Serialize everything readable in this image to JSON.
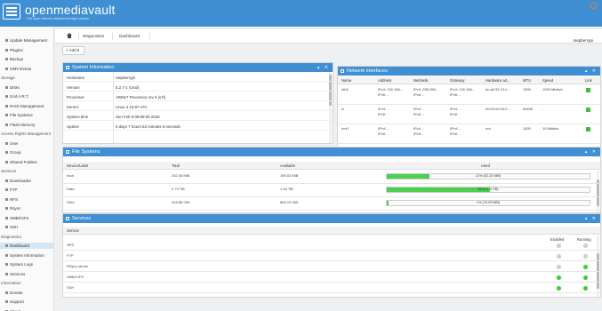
{
  "header": {
    "brand": "openmediavault",
    "tagline": "The open network attached storage solution"
  },
  "sidebar": {
    "items": [
      {
        "label": "Update Management",
        "type": "entry"
      },
      {
        "label": "Plugins",
        "type": "entry"
      },
      {
        "label": "Backup",
        "type": "entry"
      },
      {
        "label": "OMV-Extras",
        "type": "entry"
      },
      {
        "label": "Storage",
        "type": "cat"
      },
      {
        "label": "Disks",
        "type": "entry"
      },
      {
        "label": "S.M.A.R.T.",
        "type": "entry"
      },
      {
        "label": "RAID Management",
        "type": "entry"
      },
      {
        "label": "File Systems",
        "type": "entry"
      },
      {
        "label": "Flash Memory",
        "type": "entry"
      },
      {
        "label": "Access Rights Management",
        "type": "cat"
      },
      {
        "label": "User",
        "type": "entry"
      },
      {
        "label": "Group",
        "type": "entry"
      },
      {
        "label": "Shared Folders",
        "type": "entry"
      },
      {
        "label": "Services",
        "type": "cat"
      },
      {
        "label": "Downloader",
        "type": "entry"
      },
      {
        "label": "FTP",
        "type": "entry"
      },
      {
        "label": "NFS",
        "type": "entry"
      },
      {
        "label": "Rsync",
        "type": "entry"
      },
      {
        "label": "SMB/CIFS",
        "type": "entry"
      },
      {
        "label": "SSH",
        "type": "entry"
      },
      {
        "label": "Diagnostics",
        "type": "cat"
      },
      {
        "label": "Dashboard",
        "type": "entry",
        "active": true
      },
      {
        "label": "System Information",
        "type": "entry"
      },
      {
        "label": "System Logs",
        "type": "entry"
      },
      {
        "label": "Services",
        "type": "entry"
      },
      {
        "label": "Information",
        "type": "cat"
      },
      {
        "label": "Donate",
        "type": "entry"
      },
      {
        "label": "Support",
        "type": "entry"
      },
      {
        "label": "About",
        "type": "entry"
      }
    ]
  },
  "breadcrumb": {
    "items": [
      "Diagnostics",
      "Dashboard"
    ],
    "hostname": "raspberrypi"
  },
  "toolbar": {
    "add_label": "Add"
  },
  "system_info": {
    "title": "System Information",
    "rows": [
      {
        "key": "Hostname",
        "value": "raspberrypi"
      },
      {
        "key": "Version",
        "value": "5.2.7-1 (Usul)"
      },
      {
        "key": "Processor",
        "value": "ARMv7 Processor rev 3 (v7l)"
      },
      {
        "key": "Kernel",
        "value": "Linux 4.19.97-v7l+"
      },
      {
        "key": "System time",
        "value": "Sun Feb 9 09:59:06 2020"
      },
      {
        "key": "Uptime",
        "value": "0 days 7 hours 52 minutes 6 seconds"
      }
    ]
  },
  "network": {
    "title": "Network Interfaces",
    "columns": [
      "Name",
      "Address",
      "Netmask",
      "Gateway",
      "Hardware ad...",
      "MTU",
      "Speed",
      "Link"
    ],
    "rows": [
      {
        "name": "eth0",
        "address": [
          "IPv4: 192.168...",
          "IPv6: -"
        ],
        "netmask": [
          "IPv4: 255.255...",
          "IPv6: -"
        ],
        "gateway": [
          "IPv4: 192.168...",
          "IPv6: -"
        ],
        "hw": "dc:a6:32:13:1...",
        "mtu": "1500",
        "speed": "1000 Mbits/s",
        "link": true
      },
      {
        "name": "lo",
        "address": [
          "IPv4: -",
          "IPv6: -"
        ],
        "netmask": [
          "IPv4: -",
          "IPv6: -"
        ],
        "gateway": [
          "IPv4: -",
          "IPv6: -"
        ],
        "hw": "00:00:00:00:0...",
        "mtu": "65536",
        "speed": "-",
        "link": true
      },
      {
        "name": "tun0",
        "address": [
          "IPv4: -",
          "IPv6: -"
        ],
        "netmask": [
          "IPv4: -",
          "IPv6: -"
        ],
        "gateway": [
          "IPv4: -",
          "IPv6: -"
        ],
        "hw": "n/a",
        "mtu": "1500",
        "speed": "10 Mbits/s",
        "link": true
      }
    ]
  },
  "filesystems": {
    "title": "File Systems",
    "columns": [
      "Device/Label",
      "Total",
      "Available",
      "Used"
    ],
    "rows": [
      {
        "label": "boot",
        "total": "252.06 MiB",
        "available": "199.83 MiB",
        "used_pct": 21,
        "used_text": "21% (52.23 MiB)"
      },
      {
        "label": "Data",
        "total": "2.73 TiB",
        "available": "1.33 TiB",
        "used_pct": 51,
        "used_text": "51% (1.4 TiB)"
      },
      {
        "label": "Files",
        "total": "915.85 GiB",
        "available": "869.22 GiB",
        "used_pct": 1,
        "used_text": "1% (79.03 MiB)"
      }
    ]
  },
  "services": {
    "title": "Services",
    "columns": [
      "Service",
      "Enabled",
      "Running"
    ],
    "rows": [
      {
        "name": "NFS",
        "enabled": false,
        "running": false
      },
      {
        "name": "FTP",
        "enabled": false,
        "running": false
      },
      {
        "name": "RSync server",
        "enabled": false,
        "running": true
      },
      {
        "name": "SMB/CIFS",
        "enabled": true,
        "running": true
      },
      {
        "name": "SSH",
        "enabled": true,
        "running": true
      }
    ]
  },
  "colors": {
    "accent": "#3f8fd2",
    "ok": "#3ecf3e",
    "off": "#cfcfcf",
    "power": "#f07b2f"
  }
}
